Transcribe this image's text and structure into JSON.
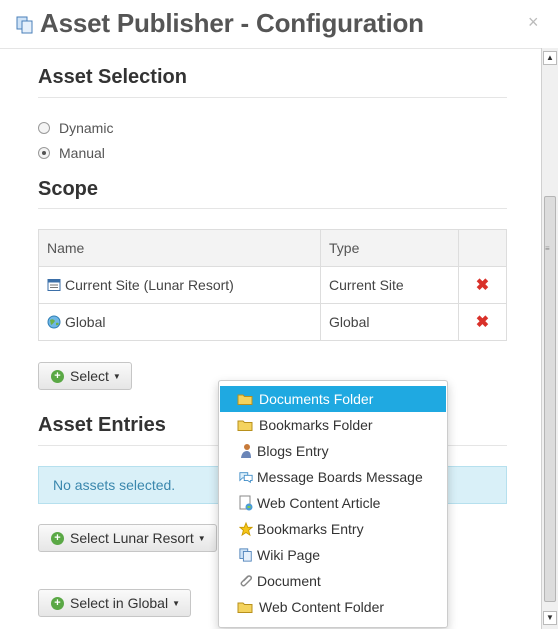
{
  "dialog": {
    "title": "Asset Publisher - Configuration",
    "close": "×"
  },
  "asset_selection": {
    "heading": "Asset Selection",
    "options": [
      {
        "label": "Dynamic",
        "checked": false
      },
      {
        "label": "Manual",
        "checked": true
      }
    ]
  },
  "scope": {
    "heading": "Scope",
    "columns": [
      "Name",
      "Type",
      ""
    ],
    "rows": [
      {
        "name": "Current Site (Lunar Resort)",
        "type": "Current Site",
        "icon": "site-icon"
      },
      {
        "name": "Global",
        "type": "Global",
        "icon": "globe-icon"
      }
    ],
    "delete_glyph": "✖",
    "select_button": "Select"
  },
  "asset_entries": {
    "heading": "Asset Entries",
    "empty_message": "No assets selected.",
    "select_lunar_button": "Select Lunar Resort",
    "select_global_button": "Select in Global"
  },
  "dropdown": {
    "items": [
      {
        "label": "Documents Folder",
        "icon": "folder-icon",
        "active": true
      },
      {
        "label": "Bookmarks Folder",
        "icon": "folder-icon",
        "active": false
      },
      {
        "label": "Blogs Entry",
        "icon": "blog-icon",
        "active": false
      },
      {
        "label": "Message Boards Message",
        "icon": "message-icon",
        "active": false
      },
      {
        "label": "Web Content Article",
        "icon": "article-icon",
        "active": false
      },
      {
        "label": "Bookmarks Entry",
        "icon": "star-icon",
        "active": false
      },
      {
        "label": "Wiki Page",
        "icon": "wiki-icon",
        "active": false
      },
      {
        "label": "Document",
        "icon": "paperclip-icon",
        "active": false
      },
      {
        "label": "Web Content Folder",
        "icon": "folder-icon",
        "active": false
      }
    ]
  },
  "colors": {
    "active_item": "#1fa9e1",
    "alert_bg": "#d9f0f8",
    "alert_text": "#3a87ad",
    "delete": "#d9312a",
    "add": "#5aa845"
  }
}
